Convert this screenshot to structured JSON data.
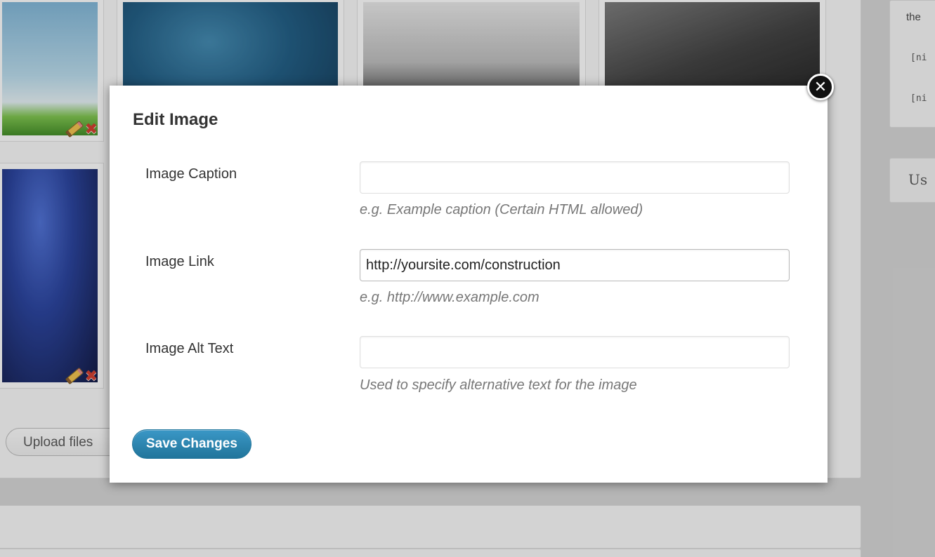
{
  "background": {
    "upload_button_label": "Upload files",
    "sidebar_text": "the",
    "sidebar_codes": [
      "[ni",
      "[ni"
    ],
    "sidebar_box_label": "Us"
  },
  "modal": {
    "title": "Edit Image",
    "fields": [
      {
        "label": "Image Caption",
        "value": "",
        "placeholder": "",
        "hint": "e.g. Example caption (Certain HTML allowed)"
      },
      {
        "label": "Image Link",
        "value": "http://yoursite.com/construction",
        "placeholder": "",
        "hint": "e.g. http://www.example.com"
      },
      {
        "label": "Image Alt Text",
        "value": "",
        "placeholder": "",
        "hint": "Used to specify alternative text for the image"
      }
    ],
    "save_label": "Save Changes",
    "close_symbol": "✕"
  },
  "icons": [
    "close-icon",
    "pencil-icon",
    "delete-icon"
  ],
  "colors": {
    "primary_button": "#21759b",
    "modal_background": "#ffffff",
    "hint_text": "#777777"
  }
}
